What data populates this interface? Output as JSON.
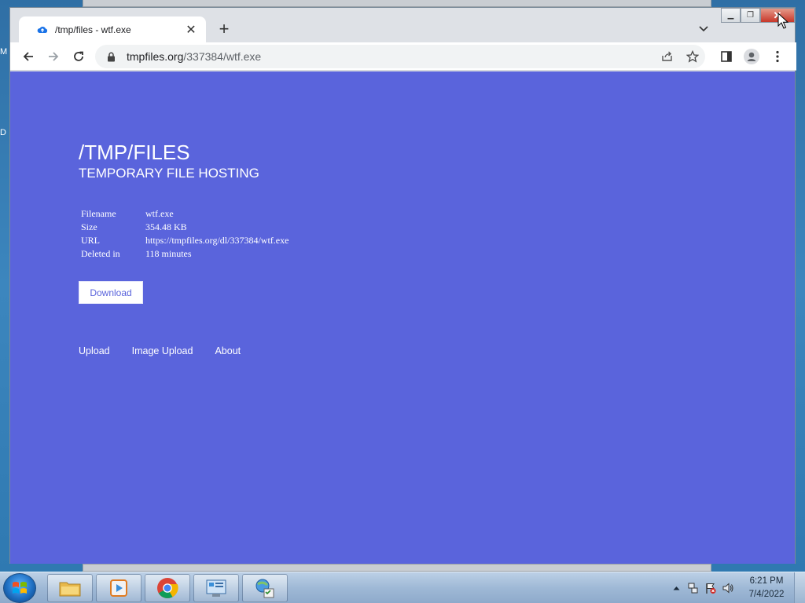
{
  "desktop": {
    "edge_label_top": "M",
    "edge_label_mid": "D"
  },
  "browser": {
    "tab": {
      "title": "/tmp/files - wtf.exe",
      "icon": "cloud-upload-icon"
    },
    "address": {
      "host": "tmpfiles.org",
      "path": "/337384/wtf.exe"
    }
  },
  "page": {
    "title": "/TMP/FILES",
    "subtitle": "TEMPORARY FILE HOSTING",
    "info": [
      {
        "label": "Filename",
        "value": "wtf.exe"
      },
      {
        "label": "Size",
        "value": "354.48 KB"
      },
      {
        "label": "URL",
        "value": "https://tmpfiles.org/dl/337384/wtf.exe"
      },
      {
        "label": "Deleted in",
        "value": "118 minutes"
      }
    ],
    "download_label": "Download",
    "nav": [
      "Upload",
      "Image Upload",
      "About"
    ],
    "colors": {
      "background": "#5a64dc",
      "text": "#ffffff"
    }
  },
  "taskbar": {
    "apps": [
      "file-explorer-icon",
      "media-player-icon",
      "chrome-icon",
      "control-panel-icon",
      "network-icon"
    ],
    "clock": {
      "time": "6:21 PM",
      "date": "7/4/2022"
    }
  }
}
